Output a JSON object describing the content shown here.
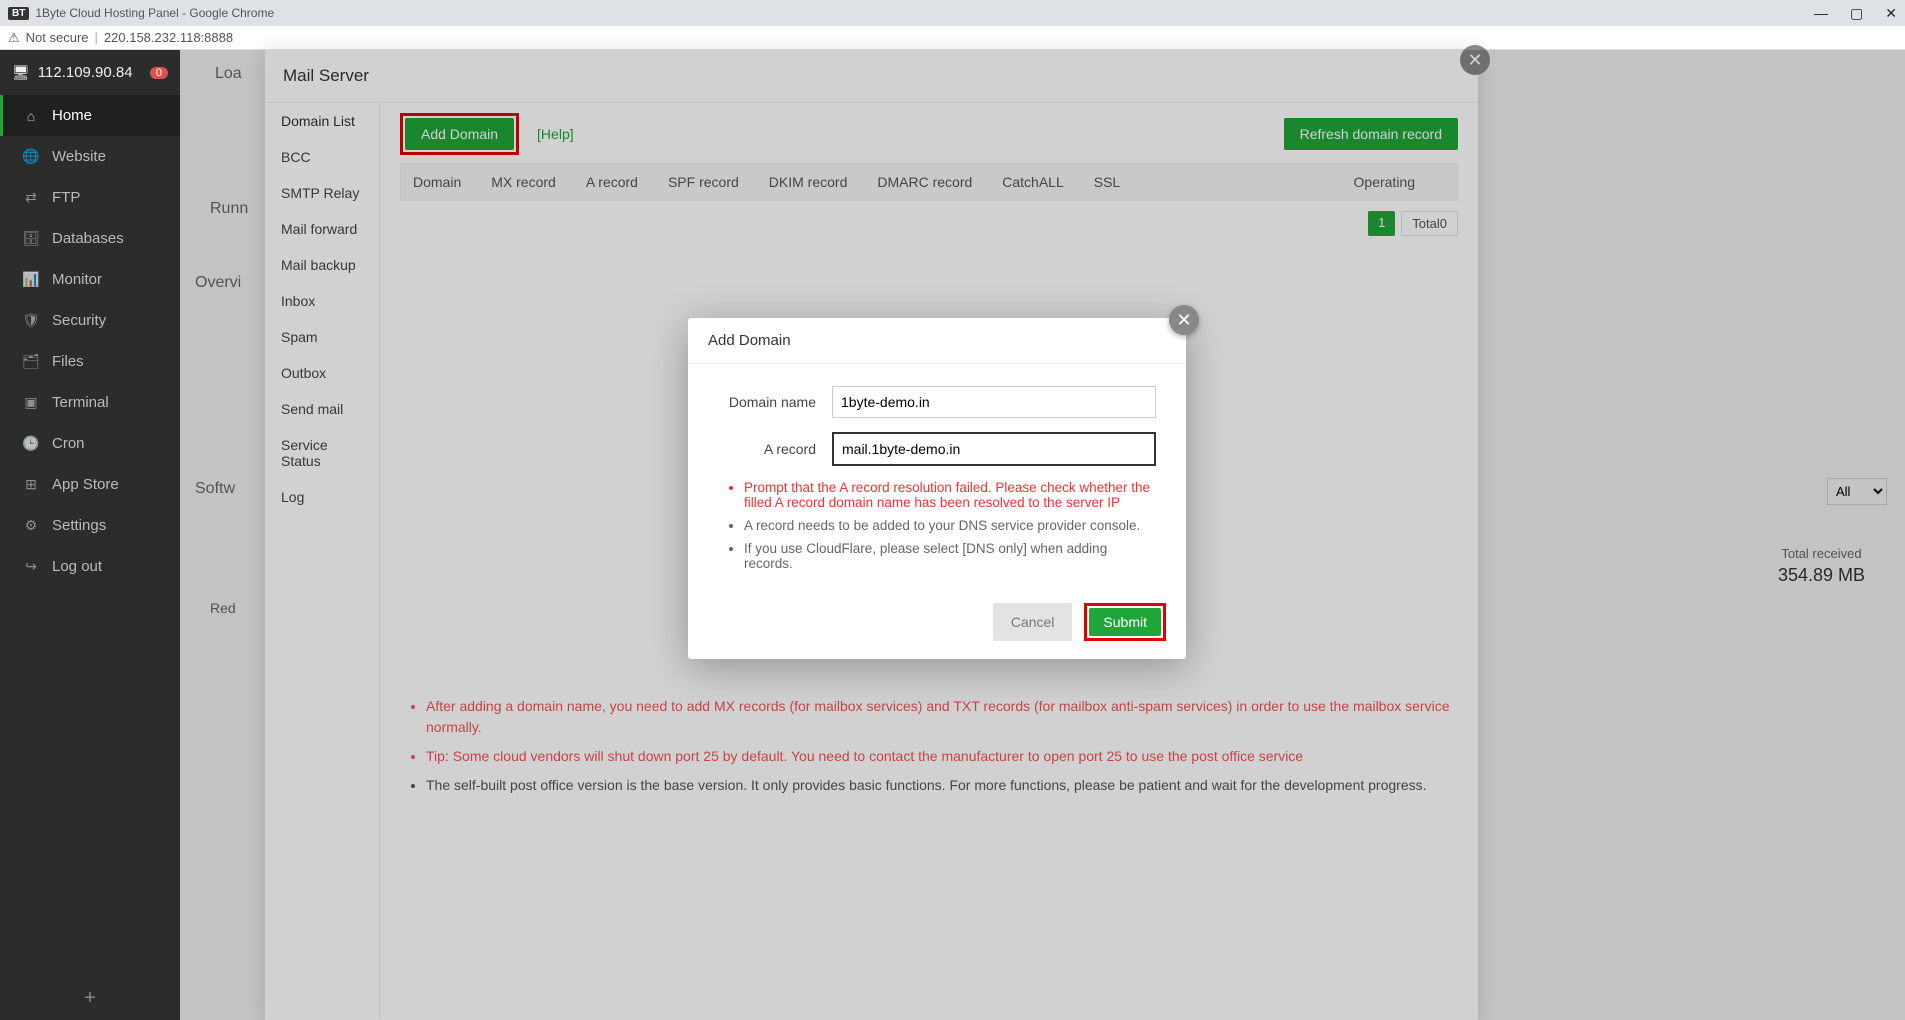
{
  "window": {
    "title_badge": "BT",
    "title": "1Byte Cloud Hosting Panel - Google Chrome"
  },
  "addressbar": {
    "insecure_label": "Not secure",
    "url": "220.158.232.118:8888"
  },
  "sidebar": {
    "server_ip": "112.109.90.84",
    "alert_badge": "0",
    "items": [
      {
        "icon": "⌂",
        "label": "Home",
        "active": true
      },
      {
        "icon": "🌐",
        "label": "Website"
      },
      {
        "icon": "⇄",
        "label": "FTP"
      },
      {
        "icon": "🗄",
        "label": "Databases"
      },
      {
        "icon": "📊",
        "label": "Monitor"
      },
      {
        "icon": "🛡",
        "label": "Security"
      },
      {
        "icon": "🗂",
        "label": "Files"
      },
      {
        "icon": "▣",
        "label": "Terminal"
      },
      {
        "icon": "🕒",
        "label": "Cron"
      },
      {
        "icon": "⊞",
        "label": "App Store"
      },
      {
        "icon": "⚙",
        "label": "Settings"
      },
      {
        "icon": "↪",
        "label": "Log out"
      }
    ]
  },
  "bg": {
    "load": "Loa",
    "run": "Runn",
    "overview": "Overvi",
    "software": "Softw",
    "redis": "Red"
  },
  "mailpanel": {
    "title": "Mail Server",
    "tabs": [
      "Domain List",
      "BCC",
      "SMTP Relay",
      "Mail forward",
      "Mail backup",
      "Inbox",
      "Spam",
      "Outbox",
      "Send mail",
      "Service Status",
      "Log"
    ],
    "toolbar": {
      "add_domain": "Add Domain",
      "help": "[Help]",
      "refresh": "Refresh domain record"
    },
    "columns": [
      "Domain",
      "MX record",
      "A record",
      "SPF record",
      "DKIM record",
      "DMARC record",
      "CatchALL",
      "SSL",
      "Operating"
    ],
    "pager_current": "1",
    "pager_total": "Total0",
    "tips": [
      {
        "red": true,
        "text": "After adding a domain name, you need to add MX records (for mailbox services) and TXT records (for mailbox anti-spam services) in order to use the mailbox service normally."
      },
      {
        "red": true,
        "text": "Tip: Some cloud vendors will shut down port 25 by default. You need to contact the manufacturer to open port 25 to use the post office service"
      },
      {
        "red": false,
        "text": "The self-built post office version is the base version. It only provides basic functions. For more functions, please be patient and wait for the development progress."
      }
    ]
  },
  "rightpanel": {
    "filter_option": "All",
    "stat_label": "Total received",
    "stat_value": "354.89 MB"
  },
  "modal": {
    "title": "Add Domain",
    "domain_label": "Domain name",
    "domain_value": "1byte-demo.in",
    "arecord_label": "A record",
    "arecord_value": "mail.1byte-demo.in",
    "notes": [
      {
        "err": true,
        "text": "Prompt that the A record resolution failed. Please check whether the filled A record domain name has been resolved to the server IP"
      },
      {
        "err": false,
        "text": "A record needs to be added to your DNS service provider console."
      },
      {
        "err": false,
        "text": "If you use CloudFlare, please select [DNS only] when adding records."
      }
    ],
    "cancel": "Cancel",
    "submit": "Submit"
  }
}
